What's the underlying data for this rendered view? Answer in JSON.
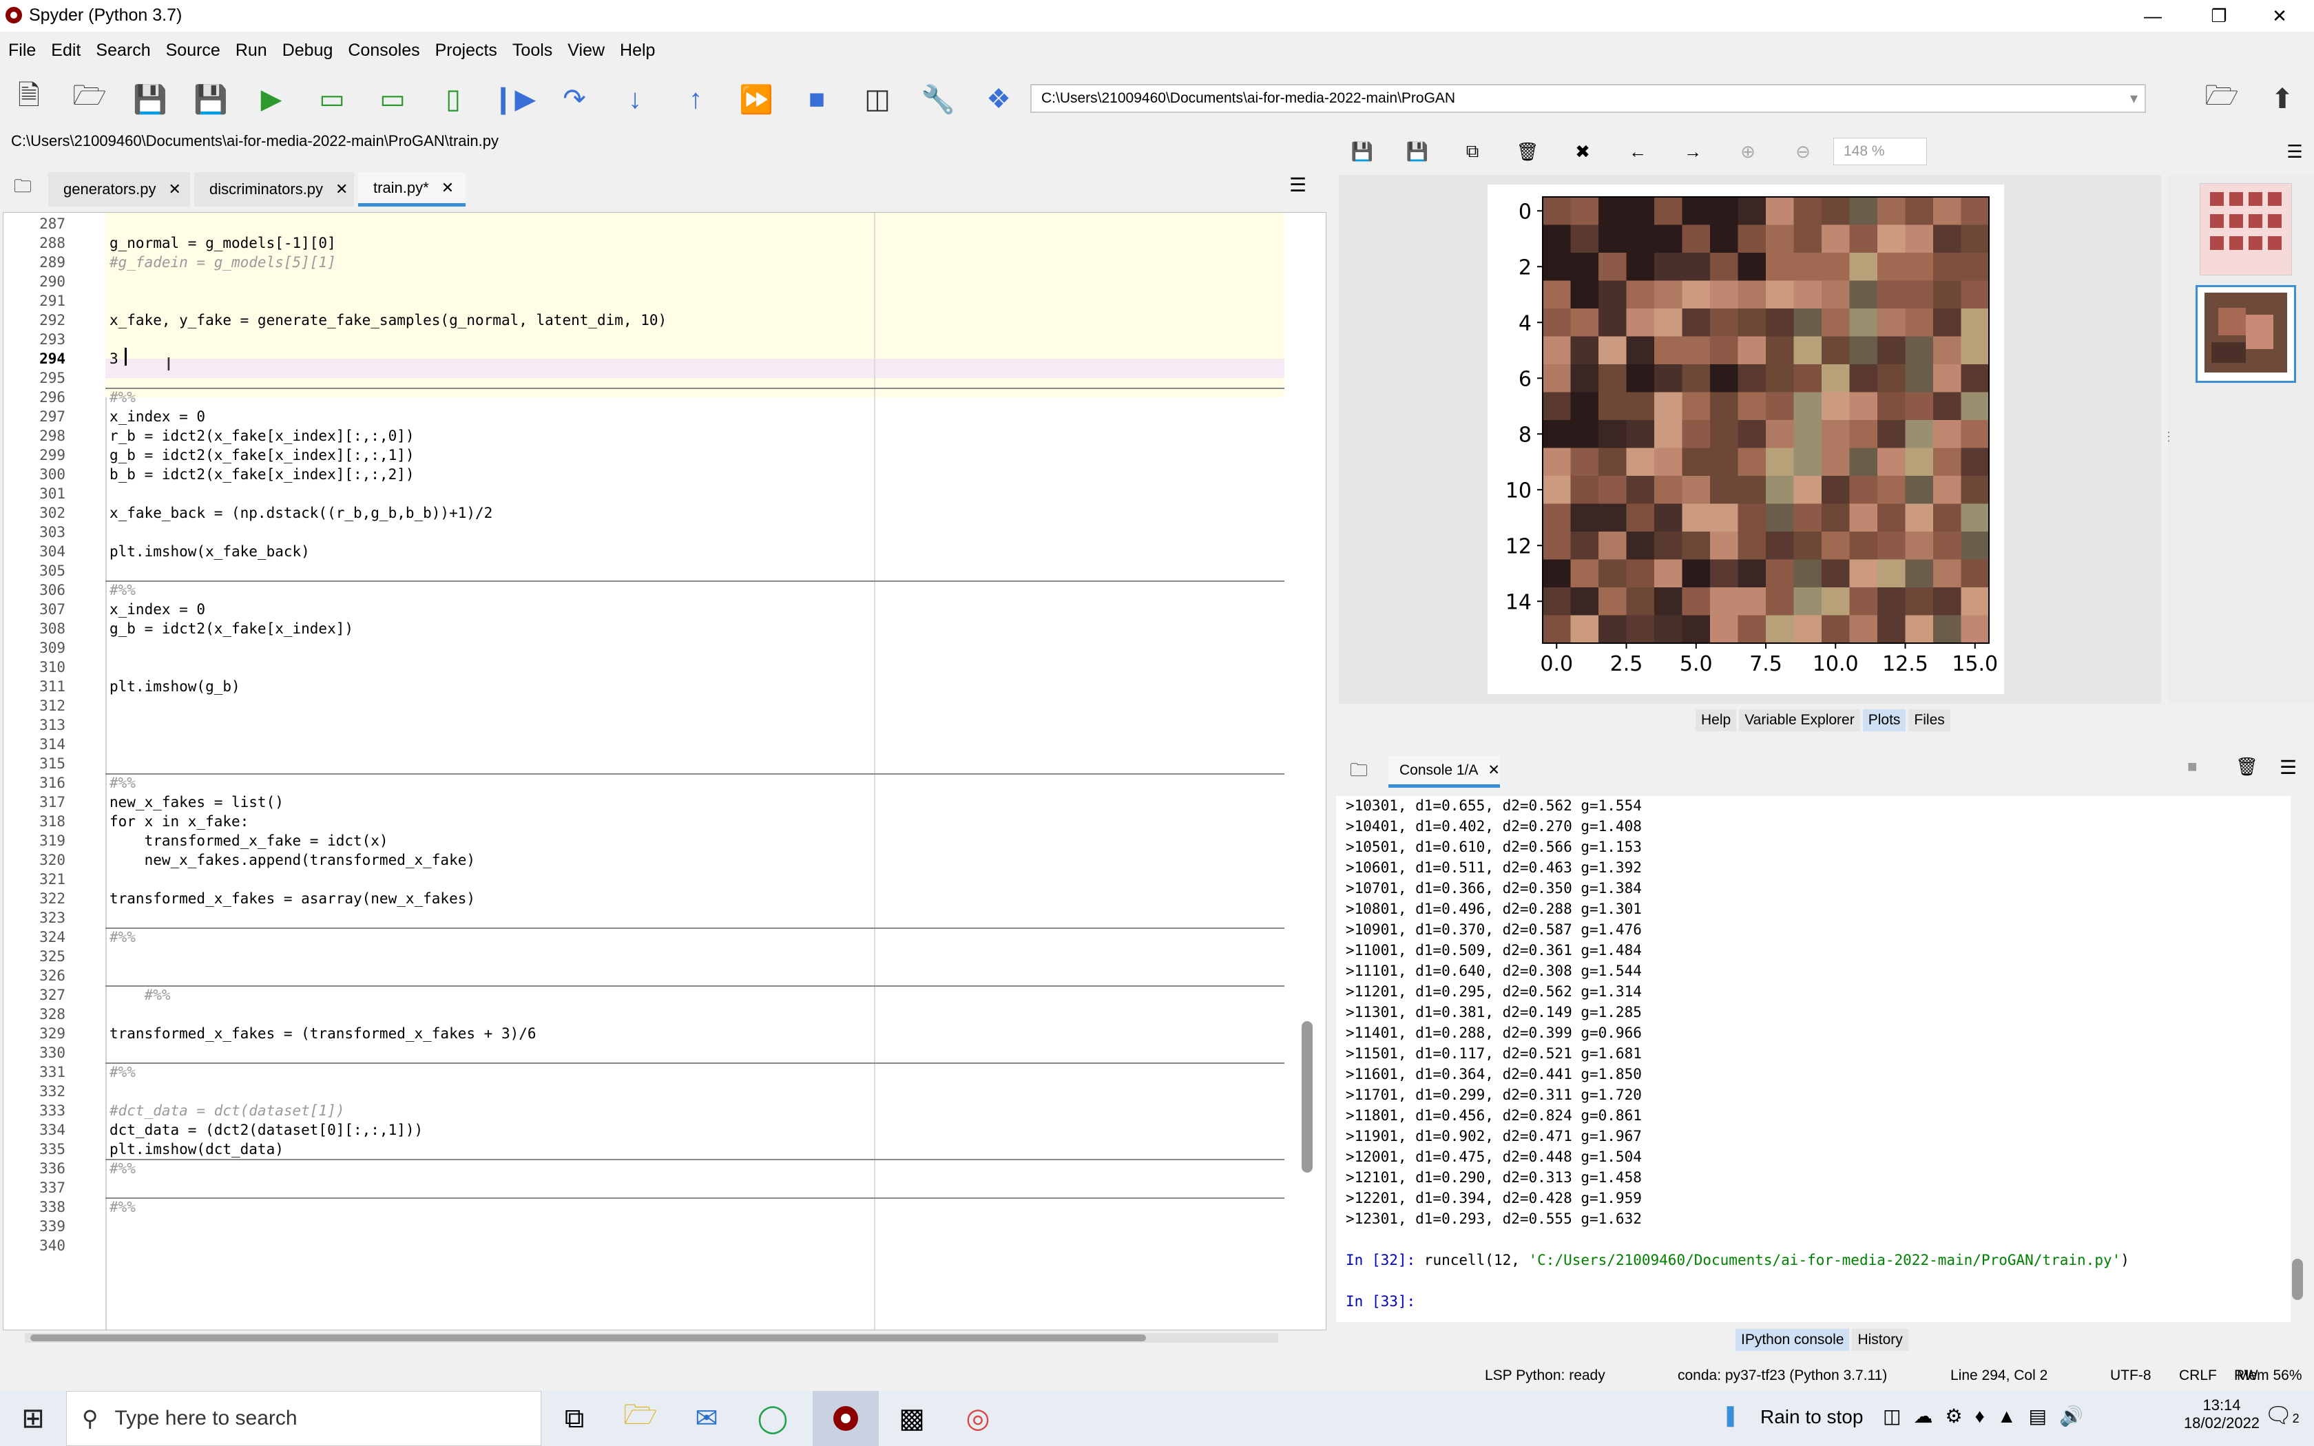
{
  "window": {
    "title": "Spyder (Python 3.7)"
  },
  "menu": [
    "File",
    "Edit",
    "Search",
    "Source",
    "Run",
    "Debug",
    "Consoles",
    "Projects",
    "Tools",
    "View",
    "Help"
  ],
  "toolbar": {
    "path": "C:\\Users\\21009460\\Documents\\ai-for-media-2022-main\\ProGAN"
  },
  "editor": {
    "file_path": "C:\\Users\\21009460\\Documents\\ai-for-media-2022-main\\ProGAN\\train.py",
    "tabs": [
      "generators.py",
      "discriminators.py",
      "train.py*"
    ],
    "active_tab": 2,
    "lines": [
      {
        "n": "287",
        "t": ""
      },
      {
        "n": "288",
        "t": "g_normal = g_models[-1][0]"
      },
      {
        "n": "289",
        "t": "#g_fadein = g_models[5][1]"
      },
      {
        "n": "290",
        "t": ""
      },
      {
        "n": "291",
        "t": ""
      },
      {
        "n": "292",
        "t": "x_fake, y_fake = generate_fake_samples(g_normal, latent_dim, 10)"
      },
      {
        "n": "293",
        "t": ""
      },
      {
        "n": "294",
        "t": "3"
      },
      {
        "n": "295",
        "t": ""
      },
      {
        "n": "296",
        "t": "#%%"
      },
      {
        "n": "297",
        "t": "x_index = 0"
      },
      {
        "n": "298",
        "t": "r_b = idct2(x_fake[x_index][:,:,0])"
      },
      {
        "n": "299",
        "t": "g_b = idct2(x_fake[x_index][:,:,1])"
      },
      {
        "n": "300",
        "t": "b_b = idct2(x_fake[x_index][:,:,2])"
      },
      {
        "n": "301",
        "t": ""
      },
      {
        "n": "302",
        "t": "x_fake_back = (np.dstack((r_b,g_b,b_b))+1)/2"
      },
      {
        "n": "303",
        "t": ""
      },
      {
        "n": "304",
        "t": "plt.imshow(x_fake_back)"
      },
      {
        "n": "305",
        "t": ""
      },
      {
        "n": "306",
        "t": "#%%"
      },
      {
        "n": "307",
        "t": "x_index = 0"
      },
      {
        "n": "308",
        "t": "g_b = idct2(x_fake[x_index])"
      },
      {
        "n": "309",
        "t": ""
      },
      {
        "n": "310",
        "t": ""
      },
      {
        "n": "311",
        "t": "plt.imshow(g_b)"
      },
      {
        "n": "312",
        "t": ""
      },
      {
        "n": "313",
        "t": ""
      },
      {
        "n": "314",
        "t": ""
      },
      {
        "n": "315",
        "t": ""
      },
      {
        "n": "316",
        "t": "#%%"
      },
      {
        "n": "317",
        "t": "new_x_fakes = list()"
      },
      {
        "n": "318",
        "t": "for x in x_fake:"
      },
      {
        "n": "319",
        "t": "    transformed_x_fake = idct(x)"
      },
      {
        "n": "320",
        "t": "    new_x_fakes.append(transformed_x_fake)"
      },
      {
        "n": "321",
        "t": ""
      },
      {
        "n": "322",
        "t": "transformed_x_fakes = asarray(new_x_fakes)"
      },
      {
        "n": "323",
        "t": ""
      },
      {
        "n": "324",
        "t": "#%%"
      },
      {
        "n": "325",
        "t": ""
      },
      {
        "n": "326",
        "t": ""
      },
      {
        "n": "327",
        "t": "    #%%"
      },
      {
        "n": "328",
        "t": ""
      },
      {
        "n": "329",
        "t": "transformed_x_fakes = (transformed_x_fakes + 3)/6"
      },
      {
        "n": "330",
        "t": ""
      },
      {
        "n": "331",
        "t": "#%%"
      },
      {
        "n": "332",
        "t": ""
      },
      {
        "n": "333",
        "t": "#dct_data = dct(dataset[1])"
      },
      {
        "n": "334",
        "t": "dct_data = (dct2(dataset[0][:,:,1]))"
      },
      {
        "n": "335",
        "t": "plt.imshow(dct_data)"
      },
      {
        "n": "336",
        "t": "#%%"
      },
      {
        "n": "337",
        "t": ""
      },
      {
        "n": "338",
        "t": "#%%"
      },
      {
        "n": "339",
        "t": ""
      },
      {
        "n": "340",
        "t": ""
      }
    ]
  },
  "plots": {
    "zoom": "148 %",
    "pane_tabs": [
      "Help",
      "Variable Explorer",
      "Plots",
      "Files"
    ],
    "active_pane_tab": 2
  },
  "chart_data": {
    "type": "heatmap",
    "x_ticks": [
      "0.0",
      "2.5",
      "5.0",
      "7.5",
      "10.0",
      "12.5",
      "15.0"
    ],
    "y_ticks": [
      "0",
      "2",
      "4",
      "6",
      "8",
      "10",
      "12",
      "14"
    ],
    "grid_size": [
      16,
      16
    ],
    "xlim": [
      -0.5,
      15.5
    ],
    "ylim": [
      15.5,
      -0.5
    ]
  },
  "console": {
    "tab_label": "Console 1/A",
    "log": [
      ">10301, d1=0.655, d2=0.562 g=1.554",
      ">10401, d1=0.402, d2=0.270 g=1.408",
      ">10501, d1=0.610, d2=0.566 g=1.153",
      ">10601, d1=0.511, d2=0.463 g=1.392",
      ">10701, d1=0.366, d2=0.350 g=1.384",
      ">10801, d1=0.496, d2=0.288 g=1.301",
      ">10901, d1=0.370, d2=0.587 g=1.476",
      ">11001, d1=0.509, d2=0.361 g=1.484",
      ">11101, d1=0.640, d2=0.308 g=1.544",
      ">11201, d1=0.295, d2=0.562 g=1.314",
      ">11301, d1=0.381, d2=0.149 g=1.285",
      ">11401, d1=0.288, d2=0.399 g=0.966",
      ">11501, d1=0.117, d2=0.521 g=1.681",
      ">11601, d1=0.364, d2=0.441 g=1.850",
      ">11701, d1=0.299, d2=0.311 g=1.720",
      ">11801, d1=0.456, d2=0.824 g=0.861",
      ">11901, d1=0.902, d2=0.471 g=1.967",
      ">12001, d1=0.475, d2=0.448 g=1.504",
      ">12101, d1=0.290, d2=0.313 g=1.458",
      ">12201, d1=0.394, d2=0.428 g=1.959",
      ">12301, d1=0.293, d2=0.555 g=1.632"
    ],
    "prompt1": "In [32]: ",
    "cmd1": "runcell(12, ",
    "cmd1_str": "'C:/Users/21009460/Documents/ai-for-media-2022-main/ProGAN/train.py'",
    "cmd1_end": ")",
    "prompt2": "In [33]:",
    "bottom_tabs": [
      "IPython console",
      "History"
    ]
  },
  "status": {
    "lsp": "LSP Python: ready",
    "conda": "conda: py37-tf23 (Python 3.7.11)",
    "position": "Line 294, Col 2",
    "encoding": "UTF-8",
    "eol": "CRLF",
    "rw": "RW",
    "mem": "Mem 56%"
  },
  "taskbar": {
    "search_placeholder": "Type here to search",
    "weather": "Rain to stop",
    "time": "13:14",
    "date": "18/02/2022",
    "notifications": "2"
  },
  "colors": {
    "accent": "#3b8ed8",
    "line_highlight": "#fffde5",
    "current_line": "#f6eaf4",
    "prompt_blue": "#0000c0",
    "string_green": "#008000"
  }
}
